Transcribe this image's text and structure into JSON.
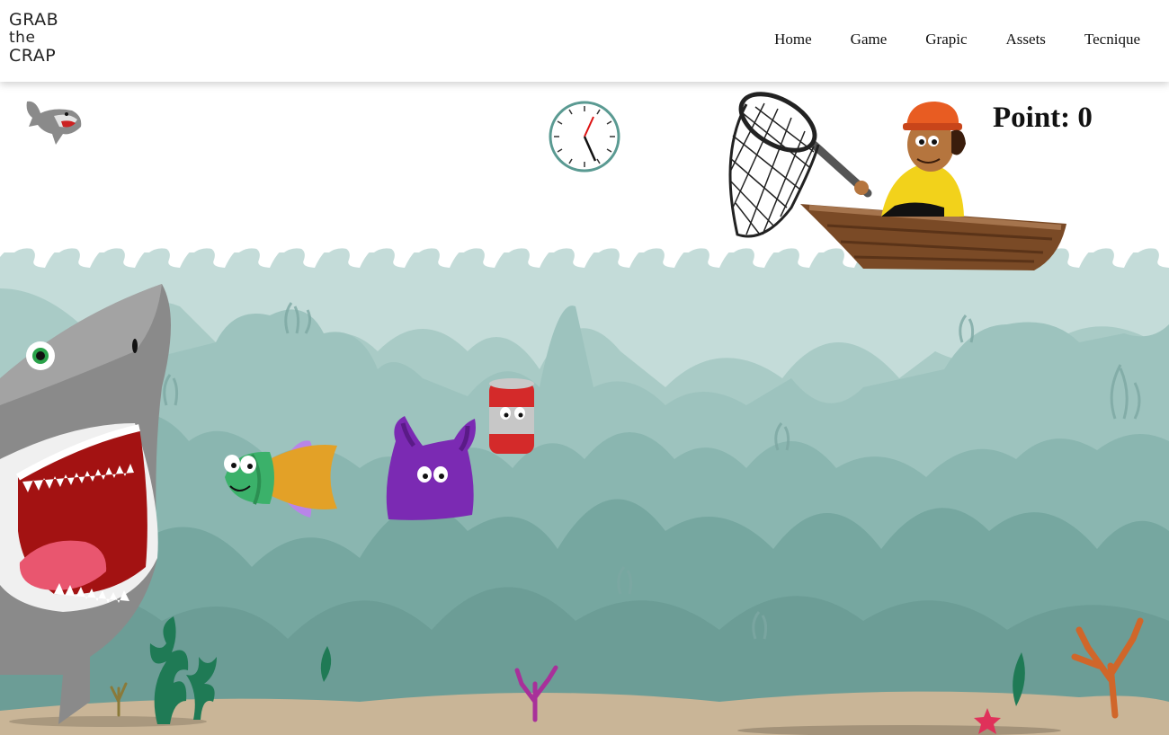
{
  "logo": {
    "line1": "GRAB",
    "line2": "the",
    "line3": "CRAP"
  },
  "nav": [
    {
      "label": "Home"
    },
    {
      "label": "Game"
    },
    {
      "label": "Grapic"
    },
    {
      "label": "Assets"
    },
    {
      "label": "Tecnique"
    }
  ],
  "hud": {
    "points_label": "Point: 0",
    "points": 0
  },
  "icons": [
    "shark-life-icon",
    "clock-icon"
  ],
  "colors": {
    "water_light": "#c5dedb",
    "water_mid": "#9cc4bf",
    "water_dark": "#6fa39c",
    "sand": "#c9b597"
  }
}
